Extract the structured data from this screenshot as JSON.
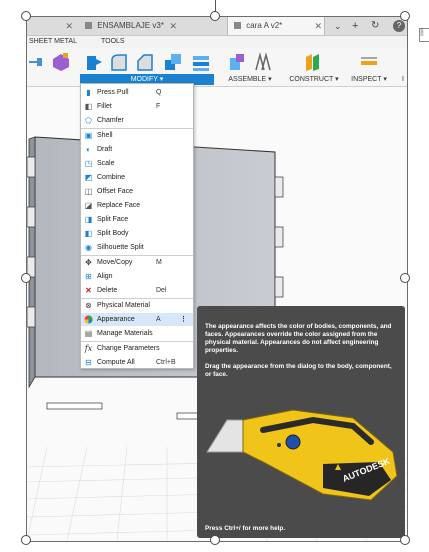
{
  "tabs": [
    {
      "label": ""
    },
    {
      "label": "ENSAMBLAJE v3*"
    },
    {
      "label": "cara A v2*"
    }
  ],
  "tab_controls": {
    "add": "+",
    "help": "?"
  },
  "sections": {
    "sheet_metal": "SHEET METAL",
    "tools": "TOOLS"
  },
  "groups": {
    "modify": "MODIFY ▾",
    "assemble": "ASSEMBLE ▾",
    "construct": "CONSTRUCT ▾",
    "inspect": "INSPECT ▾",
    "cut": "I"
  },
  "menu": {
    "items": [
      {
        "label": "Press Pull",
        "shortcut": "Q",
        "icon": "press-pull-icon"
      },
      {
        "label": "Fillet",
        "shortcut": "F",
        "icon": "fillet-icon"
      },
      {
        "label": "Chamfer",
        "shortcut": "",
        "icon": "chamfer-icon"
      },
      {
        "label": "Shell",
        "shortcut": "",
        "icon": "shell-icon"
      },
      {
        "label": "Draft",
        "shortcut": "",
        "icon": "draft-icon"
      },
      {
        "label": "Scale",
        "shortcut": "",
        "icon": "scale-icon"
      },
      {
        "label": "Combine",
        "shortcut": "",
        "icon": "combine-icon"
      },
      {
        "label": "Offset Face",
        "shortcut": "",
        "icon": "offset-face-icon"
      },
      {
        "label": "Replace Face",
        "shortcut": "",
        "icon": "replace-face-icon"
      },
      {
        "label": "Split Face",
        "shortcut": "",
        "icon": "split-face-icon"
      },
      {
        "label": "Split Body",
        "shortcut": "",
        "icon": "split-body-icon"
      },
      {
        "label": "Silhouette Split",
        "shortcut": "",
        "icon": "silhouette-split-icon"
      },
      {
        "label": "Move/Copy",
        "shortcut": "M",
        "icon": "move-icon"
      },
      {
        "label": "Align",
        "shortcut": "",
        "icon": "align-icon"
      },
      {
        "label": "Delete",
        "shortcut": "Del",
        "icon": "delete-icon"
      },
      {
        "label": "Physical Material",
        "shortcut": "",
        "icon": "physical-material-icon"
      },
      {
        "label": "Appearance",
        "shortcut": "A",
        "icon": "appearance-icon"
      },
      {
        "label": "Manage Materials",
        "shortcut": "",
        "icon": "manage-materials-icon"
      },
      {
        "label": "Change Parameters",
        "shortcut": "",
        "icon": "fx-icon"
      },
      {
        "label": "Compute All",
        "shortcut": "Ctrl+B",
        "icon": "compute-all-icon"
      }
    ],
    "more": "⋮"
  },
  "tooltip": {
    "para1": "The appearance affects the color of bodies, components, and faces. Appearances override the color assigned from the physical material. Appearances do not affect engineering properties.",
    "para2": "Drag the appearance from the dialog to the body, component, or face.",
    "brand": "AUTODESK",
    "footer": "Press Ctrl+/ for more help."
  },
  "colors": {
    "accent": "#1a82d0",
    "tooltip_bg": "#4b4b4b",
    "knife_yellow": "#f0c419",
    "highlight": "#d6e8f7"
  }
}
